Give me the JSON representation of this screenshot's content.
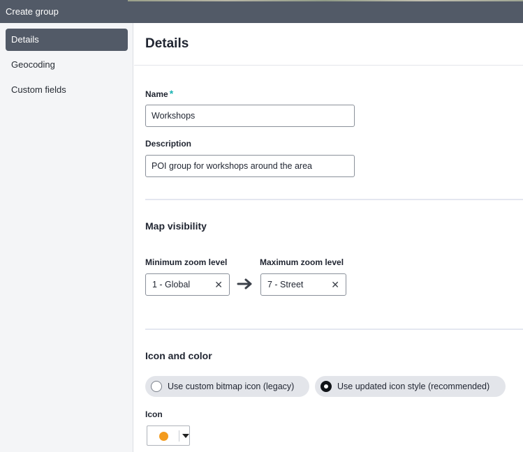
{
  "window": {
    "title": "Create group"
  },
  "sidebar": {
    "items": [
      {
        "label": "Details",
        "active": true
      },
      {
        "label": "Geocoding",
        "active": false
      },
      {
        "label": "Custom fields",
        "active": false
      }
    ]
  },
  "main": {
    "title": "Details",
    "name": {
      "label": "Name",
      "required_mark": "*",
      "value": "Workshops"
    },
    "description": {
      "label": "Description",
      "value": "POI group for workshops around the area"
    },
    "map_visibility": {
      "title": "Map visibility",
      "min_zoom": {
        "label": "Minimum zoom level",
        "value": "1 - Global",
        "clear": "✕"
      },
      "max_zoom": {
        "label": "Maximum zoom level",
        "value": "7 - Street",
        "clear": "✕"
      },
      "arrow_icon": "arrow-right-icon"
    },
    "icon_and_color": {
      "title": "Icon and color",
      "options": [
        {
          "label": "Use custom bitmap icon (legacy)",
          "selected": false
        },
        {
          "label": "Use updated icon style (recommended)",
          "selected": true
        }
      ],
      "icon_label": "Icon",
      "icon_color": "#f39b1d"
    }
  },
  "colors": {
    "titlebar": "#525a67",
    "accent_required": "#1ab3b3",
    "active_nav": "#525a67"
  }
}
